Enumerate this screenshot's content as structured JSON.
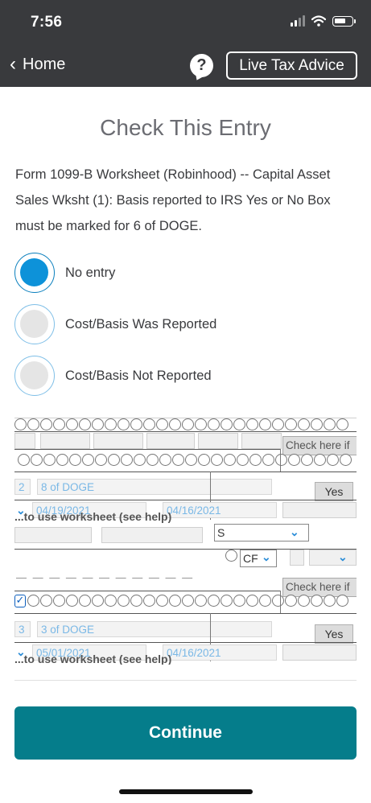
{
  "status_bar": {
    "time": "7:56"
  },
  "nav": {
    "back_label": "Home",
    "help_symbol": "?",
    "live_tax_advice_label": "Live Tax Advice"
  },
  "page": {
    "title": "Check This Entry",
    "description": "Form 1099-B Worksheet (Robinhood) -- Capital Asset Sales Wksht (1): Basis reported to IRS Yes or No Box must be marked for 6 of DOGE."
  },
  "options": [
    {
      "label": "No entry",
      "selected": true
    },
    {
      "label": "Cost/Basis Was Reported",
      "selected": false
    },
    {
      "label": "Cost/Basis Not Reported",
      "selected": false
    }
  ],
  "worksheet": {
    "check_here_1": "Check here if",
    "row1_number": "2",
    "row1_description": "8 of DOGE",
    "row1_yes": "Yes",
    "row1_date_acquired": "04/19/2021",
    "row1_date_sold": "04/16/2021",
    "use_worksheet_1": "...to use worksheet (see help)",
    "select_s_value": "S",
    "select_cf_value": "CF",
    "check_here_2": "Check here if",
    "row2_number": "3",
    "row2_description": "3 of DOGE",
    "row2_yes": "Yes",
    "row2_date_acquired": "05/01/2021",
    "row2_date_sold": "04/16/2021",
    "use_worksheet_2": "...to use worksheet (see help)"
  },
  "continue_label": "Continue",
  "colors": {
    "header_bg": "#393a3d",
    "radio_selected": "#0d92d9",
    "continue_bg": "#057d8b"
  }
}
